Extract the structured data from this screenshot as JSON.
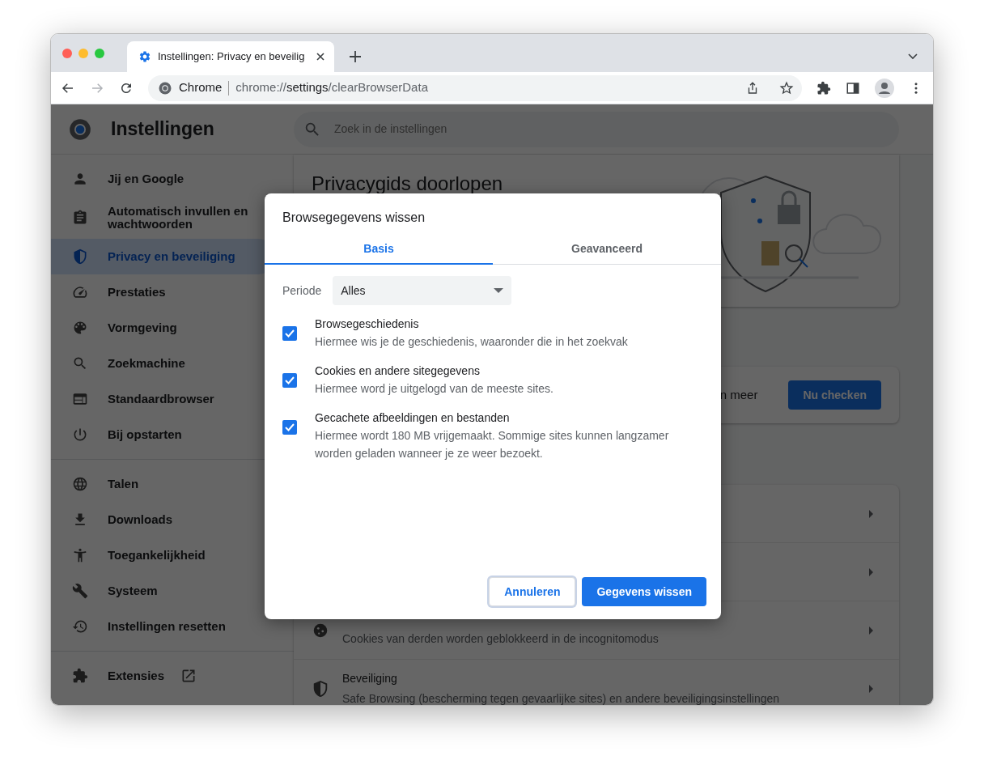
{
  "browser": {
    "tabs": [
      {
        "title": "Instellingen: Privacy en beveilig",
        "selected": true
      }
    ],
    "address": {
      "site": "Chrome",
      "url": "chrome://**settings**/clearBrowserData"
    }
  },
  "settings_header": {
    "title": "Instellingen",
    "search_placeholder": "Zoek in de instellingen"
  },
  "sidebar": {
    "groups": [
      {
        "items": [
          {
            "label": "Jij en Google",
            "kind": "page",
            "selected": false
          },
          {
            "label": "Automatisch invullen en wachtwoorden",
            "kind": "page",
            "selected": false
          },
          {
            "label": "Privacy en beveiliging",
            "kind": "page",
            "selected": true
          },
          {
            "label": "Prestaties",
            "kind": "page",
            "selected": false
          },
          {
            "label": "Vormgeving",
            "kind": "page",
            "selected": false
          },
          {
            "label": "Zoekmachine",
            "kind": "page",
            "selected": false
          },
          {
            "label": "Standaardbrowser",
            "kind": "page",
            "selected": false
          },
          {
            "label": "Bij opstarten",
            "kind": "page",
            "selected": false
          }
        ]
      },
      {
        "items": [
          {
            "label": "Talen",
            "kind": "page",
            "selected": false
          },
          {
            "label": "Downloads",
            "kind": "page",
            "selected": false
          },
          {
            "label": "Toegankelijkheid",
            "kind": "page",
            "selected": false
          },
          {
            "label": "Systeem",
            "kind": "page",
            "selected": false
          },
          {
            "label": "Instellingen resetten",
            "kind": "page",
            "selected": false
          }
        ]
      },
      {
        "items": [
          {
            "label": "Extensies",
            "kind": "external",
            "selected": false
          }
        ]
      }
    ]
  },
  "main": {
    "privacy_guide": {
      "title": "Privacygids doorlopen"
    },
    "safety_check": {
      "text": "n meer",
      "button": "Nu checken"
    },
    "rows": [
      {},
      {},
      {
        "subtitle": "Cookies van derden worden geblokkeerd in de incognitomodus"
      },
      {
        "title": "Beveiliging",
        "subtitle": "Safe Browsing (bescherming tegen gevaarlijke sites) en andere beveiligingsinstellingen"
      }
    ]
  },
  "dialog": {
    "title": "Browsegegevens wissen",
    "tabs": [
      {
        "label": "Basis",
        "selected": true
      },
      {
        "label": "Geavanceerd",
        "selected": false
      }
    ],
    "period": {
      "label": "Periode",
      "value": "Alles"
    },
    "options": [
      {
        "title": "Browsegeschiedenis",
        "description": "Hiermee wis je de geschiedenis, waaronder die in het zoekvak",
        "checked": true
      },
      {
        "title": "Cookies en andere sitegegevens",
        "description": "Hiermee word je uitgelogd van de meeste sites.",
        "checked": true
      },
      {
        "title": "Gecachete afbeeldingen en bestanden",
        "description": "Hiermee wordt 180 MB vrijgemaakt. Sommige sites kunnen langzamer worden geladen wanneer je ze weer bezoekt.",
        "checked": true
      }
    ],
    "buttons": [
      {
        "label": "Annuleren",
        "kind": "secondary"
      },
      {
        "label": "Gegevens wissen",
        "kind": "primary"
      }
    ]
  }
}
